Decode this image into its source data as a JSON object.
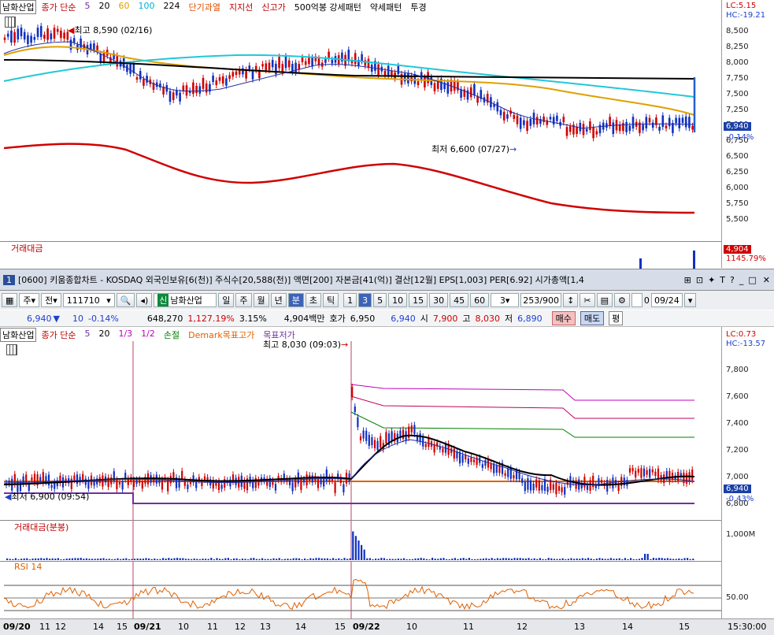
{
  "top": {
    "stock": "남화산업",
    "legend": [
      {
        "t": "종가 단순",
        "c": "#c00000"
      },
      {
        "t": "5",
        "c": "#7030a0"
      },
      {
        "t": "20",
        "c": "#000000"
      },
      {
        "t": "60",
        "c": "#e0a000"
      },
      {
        "t": "100",
        "c": "#00b0d0"
      },
      {
        "t": "224",
        "c": "#000000"
      },
      {
        "t": "단기과열",
        "c": "#e05000"
      },
      {
        "t": "지지선",
        "c": "#c00000"
      },
      {
        "t": "신고가",
        "c": "#c00000"
      },
      {
        "t": "500억봉 강세패턴",
        "c": "#000000"
      },
      {
        "t": "약세패턴",
        "c": "#000000"
      },
      {
        "t": "투경",
        "c": "#000000"
      }
    ],
    "lc": "LC:5.15",
    "hc": "HC:-19.21",
    "high_note": "최고 8,590 (02/16)",
    "low_note": "최저 6,600 (07/27)",
    "ticks": [
      "8,500",
      "8,250",
      "8,000",
      "7,750",
      "7,500",
      "7,250",
      "7,000",
      "6,750",
      "6,500",
      "6,250",
      "6,000",
      "5,750",
      "5,500"
    ],
    "price_badge": "6,940",
    "change_badge": "-0.14%",
    "volume_label": "거래대금",
    "volume_badge": "4,904",
    "volume_pct": "1145.79%"
  },
  "window": {
    "num": "1",
    "title": "[0600] 키움종합차트 - KOSDAQ 외국인보유[6(천)] 주식수[20,588(천)] 액면[200] 자본금[41(억)] 결산[12월] EPS[1,003] PER[6.92] 시가총액[1,4"
  },
  "toolbar": {
    "type": "주",
    "market": "전",
    "code": "111710",
    "name": "남화산업",
    "periods": [
      "일",
      "주",
      "월",
      "년",
      "분",
      "초",
      "틱"
    ],
    "minutes": [
      "1",
      "3",
      "5",
      "10",
      "15",
      "30",
      "45",
      "60"
    ],
    "interval": "3",
    "count": "253",
    "count_total": "/900",
    "checkbox_value": "0",
    "date": "09/24"
  },
  "info": {
    "price": "6,940",
    "arrow": "▼",
    "change": "10",
    "change_pct": "-0.14%",
    "volume": "648,270",
    "volume_pct": "1,127.19%",
    "turnover": "3.15%",
    "amount": "4,904백만",
    "ask_label": "호가",
    "ask": "6,950",
    "bid": "6,940",
    "open_label": "시",
    "open": "7,900",
    "high_label": "고",
    "high": "8,030",
    "low_label": "저",
    "low": "6,890",
    "buy": "매수",
    "sell": "매도",
    "flat": "평"
  },
  "bottom": {
    "stock": "남화산업",
    "legend": [
      {
        "t": "종가 단순",
        "c": "#c00000"
      },
      {
        "t": "5",
        "c": "#7030a0"
      },
      {
        "t": "20",
        "c": "#000000"
      },
      {
        "t": "1/3",
        "c": "#c000c0"
      },
      {
        "t": "1/2",
        "c": "#c000c0"
      },
      {
        "t": "손절",
        "c": "#008000"
      },
      {
        "t": "Demark목표고가",
        "c": "#e06000"
      },
      {
        "t": "목표저가",
        "c": "#7030a0"
      }
    ],
    "lc": "LC:0.73",
    "hc": "HC:-13.57",
    "high_note": "최고 8,030 (09:03)",
    "low_note": "최저 6,900 (09:54)",
    "ticks": [
      "7,800",
      "7,600",
      "7,400",
      "7,200",
      "7,000",
      "6,800"
    ],
    "price_badge": "6,940",
    "change_badge": "-0.43%",
    "vol_label": "거래대금(분봉)",
    "vol_tick": "1,000M",
    "rsi_label": "RSI 14",
    "rsi_tick": "50.00"
  },
  "dates": {
    "labels": [
      "09/20",
      "11",
      "12",
      "14",
      "15",
      "09/21",
      "10",
      "11",
      "12",
      "13",
      "14",
      "15",
      "09/22",
      "10",
      "11",
      "12",
      "13",
      "14",
      "15"
    ],
    "time": "15:30:00"
  }
}
